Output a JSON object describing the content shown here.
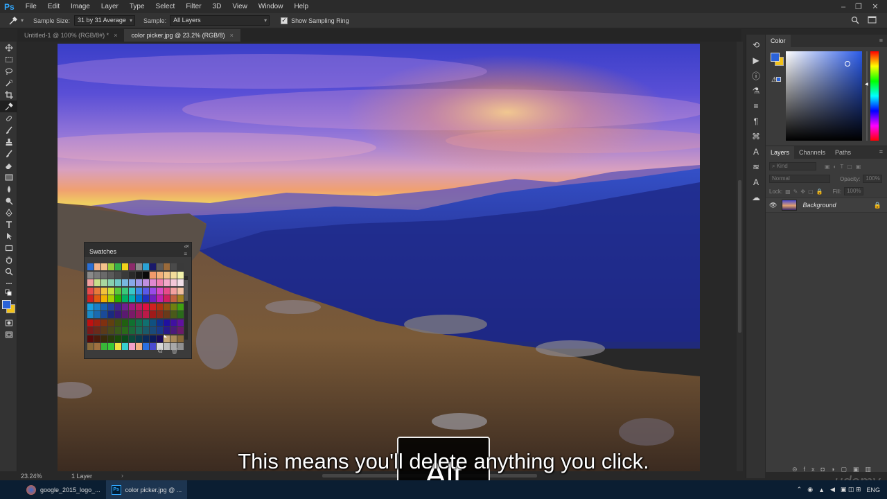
{
  "app": {
    "logo": "Ps"
  },
  "menu": [
    "File",
    "Edit",
    "Image",
    "Layer",
    "Type",
    "Select",
    "Filter",
    "3D",
    "View",
    "Window",
    "Help"
  ],
  "options": {
    "sample_size_label": "Sample Size:",
    "sample_size_value": "31 by 31 Average",
    "sample_label": "Sample:",
    "sample_value": "All Layers",
    "show_ring_label": "Show Sampling Ring"
  },
  "tabs": [
    {
      "label": "Untitled-1 @ 100% (RGB/8#) *"
    },
    {
      "label": "color picker.jpg @ 23.2% (RGB/8)"
    }
  ],
  "status": {
    "zoom": "23.24%",
    "info": "1 Layer"
  },
  "panels": {
    "color_tab": "Color",
    "layers_tabs": [
      "Layers",
      "Channels",
      "Paths"
    ],
    "kind": "Kind",
    "blend_mode": "Normal",
    "opacity_label": "Opacity:",
    "opacity_value": "100%",
    "lock_label": "Lock:",
    "fill_label": "Fill:",
    "fill_value": "100%",
    "layer_name": "Background"
  },
  "swatches": {
    "title": "Swatches",
    "rows": [
      [
        "#2a6fd6",
        "#f2b38a",
        "#f5c28a",
        "#9ccf3a",
        "#35b34a",
        "#f2d21a",
        "#8b2a6a",
        "#8a8a8a",
        "#2aa3d6",
        "#1a1a6a",
        "#5a5a5a",
        "#9a6a3a",
        "#4a4a4a",
        "#3a3a3a"
      ],
      [
        "#8a8a8a",
        "#7a7a7a",
        "#6a6a6a",
        "#5a5a5a",
        "#4a4a4a",
        "#3a3a3a",
        "#2a2a2a",
        "#1a1a1a",
        "#0a0a0a",
        "#f29a6a",
        "#f2b07a",
        "#f2c68a",
        "#f2dc9a",
        "#f2f2aa"
      ],
      [
        "#f2a0a0",
        "#c8e08a",
        "#a8d8a0",
        "#88d0b0",
        "#70c8c8",
        "#78b8e0",
        "#88a8e8",
        "#a098e8",
        "#c090e0",
        "#e088d0",
        "#f080b0",
        "#f2a8c8",
        "#f2c8d8",
        "#f2e0e8"
      ],
      [
        "#e84a4a",
        "#e87a3a",
        "#f2c23a",
        "#c8e03a",
        "#5ac83a",
        "#3ac87a",
        "#3ac8c8",
        "#3a8ae8",
        "#5a5ae8",
        "#9a4ae8",
        "#d84ac8",
        "#e84a8a",
        "#f2a0a0",
        "#f2c0a0"
      ],
      [
        "#d02020",
        "#e05a10",
        "#f2b000",
        "#a8d000",
        "#28b000",
        "#00b060",
        "#00b0b0",
        "#0070d0",
        "#2030c0",
        "#7020c0",
        "#c020b0",
        "#d02060",
        "#c06040",
        "#a08020"
      ],
      [
        "#18a0e0",
        "#1880c8",
        "#1860b0",
        "#2040a0",
        "#402090",
        "#702090",
        "#a01880",
        "#c01860",
        "#e01040",
        "#d02020",
        "#b03010",
        "#905010",
        "#708010",
        "#40a010"
      ],
      [
        "#1a8ac8",
        "#1a6ab0",
        "#1a4a98",
        "#1a2a80",
        "#3a1a78",
        "#5a1a70",
        "#7a1a68",
        "#9a1a58",
        "#ba1a48",
        "#a01a1a",
        "#8a2a1a",
        "#6a3a1a",
        "#4a5a1a",
        "#2a6a1a"
      ],
      [
        "#c01010",
        "#a02010",
        "#803010",
        "#604010",
        "#405010",
        "#206010",
        "#107030",
        "#107050",
        "#107070",
        "#105080",
        "#103090",
        "#2010a0",
        "#4010a0",
        "#6010a0"
      ],
      [
        "#7a1a1a",
        "#6a2a1a",
        "#5a3a1a",
        "#4a4a1a",
        "#3a5a1a",
        "#2a6a1a",
        "#1a6a3a",
        "#1a6a5a",
        "#1a5a6a",
        "#1a4a7a",
        "#1a3a8a",
        "#2a1a8a",
        "#4a1a7a",
        "#6a1a6a"
      ],
      [
        "#5a0a0a",
        "#4a1a0a",
        "#3a2a0a",
        "#2a3a0a",
        "#1a4a0a",
        "#0a4a1a",
        "#0a4a3a",
        "#0a3a4a",
        "#0a2a5a",
        "#0a1a5a",
        "#1a0a5a",
        "#c8a878",
        "#a88858",
        "#886838"
      ],
      [
        "#8a6a3a",
        "#a07040",
        "#38b838",
        "#38c838",
        "#f2e040",
        "#38d0d0",
        "#f2a0c8",
        "#f2b080",
        "#2a70e0",
        "#4a4ad0",
        "#d8d8d8",
        "#c0c0c0",
        "#a8a8a8",
        "#909090"
      ]
    ]
  },
  "taskbar": {
    "items": [
      {
        "label": "google_2015_logo_..."
      },
      {
        "label": "color picker.jpg @ ..."
      }
    ],
    "lang": "ENG"
  },
  "overlay": {
    "subtitle": "This means you'll delete anything you click.",
    "key": "Alt",
    "watermark": "udemy"
  },
  "colors": {
    "foreground": "#2a62d8",
    "background": "#f2c21a",
    "accent": "#31a8ff"
  }
}
